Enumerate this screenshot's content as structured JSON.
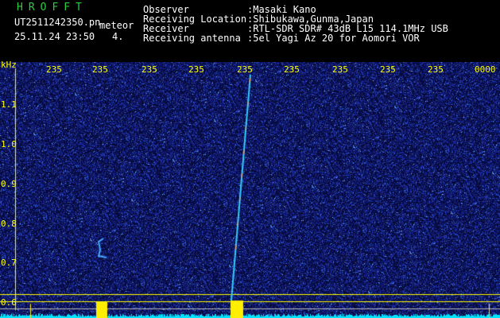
{
  "app": {
    "title": "HROFFT",
    "filename": "UT2511242350.pn",
    "mode": "meteor",
    "datetime": "25.11.24 23:50",
    "index": "4."
  },
  "info": {
    "labels": [
      "Observer",
      "Receiving Location",
      "Receiver",
      "Receiving antenna"
    ],
    "values": [
      ":Masaki Kano",
      ":Shibukawa,Gunma,Japan",
      ":RTL-SDR SDR# 43dB L15 114.1MHz USB",
      ":5el Yagi Az 20 for Aomori VOR"
    ]
  },
  "axis": {
    "unit": "kHz",
    "y_ticks": [
      "1.1",
      "1.0",
      "0.9",
      "0.8",
      "0.7",
      "0.6"
    ],
    "top_ticks": [
      "235",
      "235",
      "235",
      "235",
      "235",
      "235",
      "235",
      "235",
      "235",
      "0000"
    ]
  },
  "colors": {
    "background": "#000000",
    "noise": "#1b2a9e",
    "grid": "#ffff00",
    "text": "#ffffff",
    "title": "#2ecc40",
    "spectrum": "#00e5ff",
    "peak": "#ffee00"
  }
}
